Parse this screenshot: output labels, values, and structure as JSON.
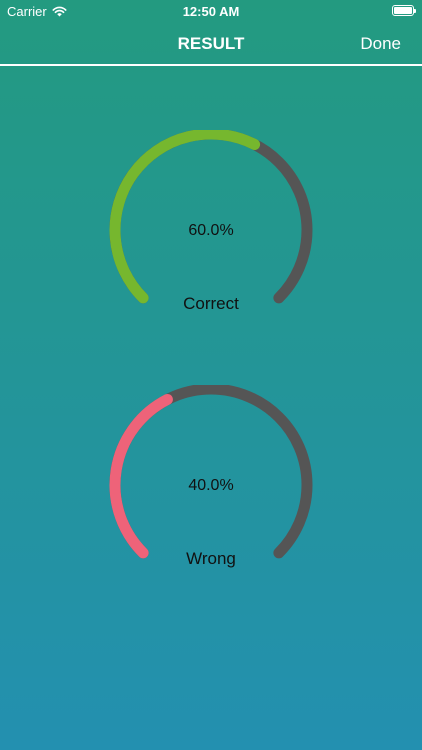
{
  "status_bar": {
    "carrier": "Carrier",
    "time": "12:50 AM",
    "wifi_icon": "wifi-icon",
    "battery_icon": "battery-icon"
  },
  "nav": {
    "title": "RESULT",
    "done_label": "Done"
  },
  "colors": {
    "track": "#555555",
    "correct": "#76b72e",
    "wrong": "#ee6379"
  },
  "results": [
    {
      "label": "Correct",
      "value_text": "60.0%",
      "fraction": 0.6
    },
    {
      "label": "Wrong",
      "value_text": "40.0%",
      "fraction": 0.4
    }
  ]
}
